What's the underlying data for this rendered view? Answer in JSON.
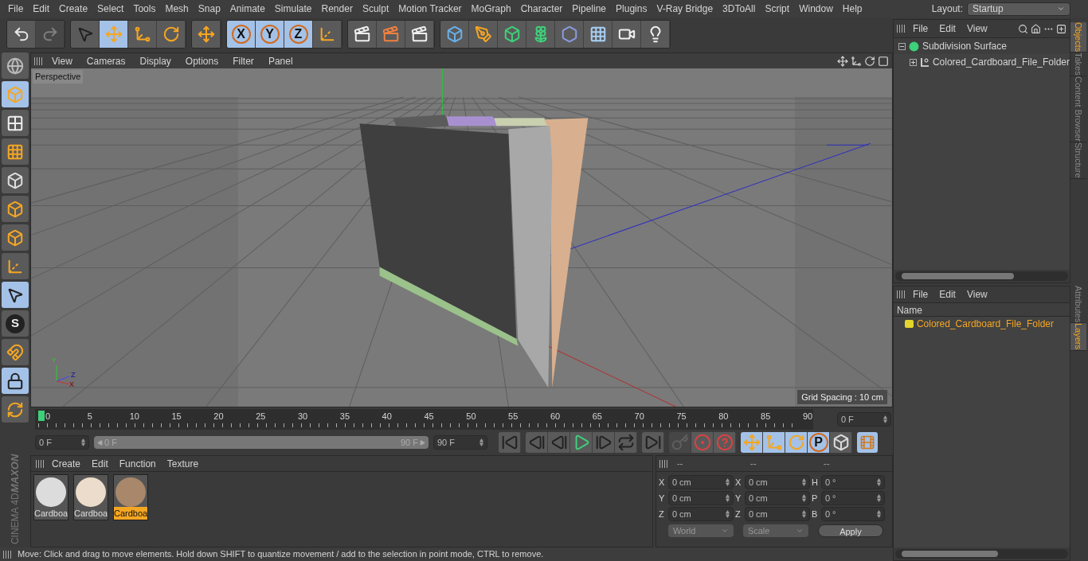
{
  "menu_bar": [
    "File",
    "Edit",
    "Create",
    "Select",
    "Tools",
    "Mesh",
    "Snap",
    "Animate",
    "Simulate",
    "Render",
    "Sculpt",
    "Motion Tracker",
    "MoGraph",
    "Character",
    "Pipeline",
    "Plugins",
    "V-Ray Bridge",
    "3DToAll",
    "Script",
    "Window",
    "Help"
  ],
  "layout": {
    "label": "Layout:",
    "value": "Startup"
  },
  "toolbar": [
    {
      "items": [
        {
          "kind": "undo",
          "selected": false,
          "disabled": false
        },
        {
          "kind": "redo",
          "selected": false,
          "disabled": true
        }
      ]
    },
    {
      "items": [
        {
          "kind": "select",
          "selected": false,
          "disabled": false
        },
        {
          "kind": "move",
          "selected": true,
          "disabled": false
        },
        {
          "kind": "scale",
          "selected": false,
          "disabled": false
        },
        {
          "kind": "rotate",
          "selected": false,
          "disabled": false
        }
      ]
    },
    {
      "items": [
        {
          "kind": "move",
          "selected": false,
          "disabled": false
        }
      ]
    },
    {
      "items": [
        {
          "kind": "axis-lock",
          "label": "X",
          "selected": true,
          "disabled": false
        },
        {
          "kind": "axis-lock",
          "label": "Y",
          "selected": true,
          "disabled": false
        },
        {
          "kind": "axis-lock",
          "label": "Z",
          "selected": true,
          "disabled": false
        },
        {
          "kind": "coords",
          "selected": false,
          "disabled": false
        }
      ]
    },
    {
      "items": [
        {
          "kind": "render-view",
          "selected": false,
          "disabled": false
        },
        {
          "kind": "render-viewer",
          "selected": false,
          "disabled": false
        },
        {
          "kind": "render-settings",
          "selected": false,
          "disabled": false
        }
      ]
    },
    {
      "items": [
        {
          "kind": "cube",
          "selected": false,
          "disabled": false
        },
        {
          "kind": "pen",
          "selected": false,
          "disabled": false
        },
        {
          "kind": "subdivision",
          "selected": false,
          "disabled": false
        },
        {
          "kind": "cloner",
          "selected": false,
          "disabled": false
        },
        {
          "kind": "deformer",
          "selected": false,
          "disabled": false
        },
        {
          "kind": "floor",
          "selected": false,
          "disabled": false
        },
        {
          "kind": "camera",
          "selected": false,
          "disabled": false
        },
        {
          "kind": "light",
          "selected": false,
          "disabled": false
        }
      ]
    }
  ],
  "left_toolbar": [
    {
      "kind": "make-editable",
      "selected": false
    },
    {
      "kind": "model",
      "selected": true
    },
    {
      "kind": "texture",
      "selected": false
    },
    {
      "kind": "workplane",
      "selected": false
    },
    {
      "kind": "points",
      "selected": false
    },
    {
      "kind": "edges",
      "selected": false
    },
    {
      "kind": "polygons",
      "selected": false
    },
    {
      "kind": "axis",
      "selected": false
    },
    {
      "kind": "tweak",
      "selected": true
    },
    {
      "kind": "snap",
      "label": "S",
      "selected": false
    },
    {
      "kind": "magnet",
      "selected": false
    },
    {
      "kind": "lock-workplane",
      "selected": true
    },
    {
      "kind": "planar",
      "selected": false
    }
  ],
  "logo": {
    "brand": "MAXON",
    "product": "CINEMA 4D"
  },
  "viewport": {
    "menu": [
      "View",
      "Cameras",
      "Display",
      "Options",
      "Filter",
      "Panel"
    ],
    "camera": "Perspective",
    "grid_spacing": "Grid Spacing : 10 cm",
    "gizmo_labels": [
      "Y",
      "Z",
      "X"
    ]
  },
  "timeline": {
    "ticks": [
      "0",
      "5",
      "10",
      "15",
      "20",
      "25",
      "30",
      "35",
      "40",
      "45",
      "50",
      "55",
      "60",
      "65",
      "70",
      "75",
      "80",
      "85",
      "90"
    ],
    "playhead": {
      "level": 0
    },
    "current_frame": "0 F",
    "start": "0 F",
    "range": {
      "start": "0 F",
      "end": "90 F",
      "level": 1
    },
    "end": "90 F",
    "transport": [
      {
        "kind": "go-start"
      },
      {
        "kind": "prev-key"
      },
      {
        "kind": "prev-frame"
      },
      {
        "kind": "play"
      },
      {
        "kind": "next-frame"
      },
      {
        "kind": "loop"
      },
      {
        "kind": "go-end"
      }
    ],
    "record": [
      {
        "kind": "auto-key",
        "disabled": true
      },
      {
        "kind": "record",
        "disabled": false
      },
      {
        "kind": "help",
        "disabled": false
      }
    ],
    "keys": [
      {
        "kind": "move",
        "selected": true
      },
      {
        "kind": "scale",
        "selected": true
      },
      {
        "kind": "rotate",
        "selected": true
      },
      {
        "kind": "param",
        "label": "P",
        "selected": true
      },
      {
        "kind": "points",
        "selected": false
      }
    ],
    "film": {
      "selected": true
    }
  },
  "materials": {
    "menu": [
      "Create",
      "Edit",
      "Function",
      "Texture"
    ],
    "items": [
      {
        "name": "Cardboa",
        "color": "#dcdcdc",
        "selected": false
      },
      {
        "name": "Cardboa",
        "color": "#ecdccb",
        "selected": false
      },
      {
        "name": "Cardboa",
        "color": "#a9876a",
        "selected": true
      }
    ]
  },
  "coordinates": {
    "headers": [
      "--",
      "--",
      "--"
    ],
    "rows": [
      {
        "axis": "X",
        "position": "0 cm",
        "size_axis": "X",
        "size": "0 cm",
        "rotation_axis": "H",
        "rotation": "0 °"
      },
      {
        "axis": "Y",
        "position": "0 cm",
        "size_axis": "Y",
        "size": "0 cm",
        "rotation_axis": "P",
        "rotation": "0 °"
      },
      {
        "axis": "Z",
        "position": "0 cm",
        "size_axis": "Z",
        "size": "0 cm",
        "rotation_axis": "B",
        "rotation": "0 °"
      }
    ],
    "space": "World",
    "mode": "Scale",
    "apply": "Apply"
  },
  "status_bar": "Move: Click and drag to move elements. Hold down SHIFT to quantize movement / add to the selection in point mode, CTRL to remove.",
  "objects_panel": {
    "menu": [
      "File",
      "Edit",
      "View"
    ],
    "tree": [
      {
        "name": "Subdivision Surface",
        "kind": "subdivision",
        "expanded": true,
        "children": [
          {
            "name": "Colored_Cardboard_File_Folder",
            "kind": "null",
            "expanded": false
          }
        ]
      }
    ]
  },
  "side_tabs_top": [
    {
      "label": "Objects",
      "selected": true
    },
    {
      "label": "Takes",
      "selected": false
    },
    {
      "label": "Content Browser",
      "selected": false
    },
    {
      "label": "Structure",
      "selected": false
    }
  ],
  "layers_panel": {
    "menu": [
      "File",
      "Edit",
      "View"
    ],
    "header": "Name",
    "rows": [
      {
        "name": "Colored_Cardboard_File_Folder",
        "color": "#e3d52a",
        "selected": true
      }
    ]
  },
  "side_tabs_bottom": [
    {
      "label": "Attributes",
      "selected": false
    },
    {
      "label": "Layers",
      "selected": true
    }
  ]
}
